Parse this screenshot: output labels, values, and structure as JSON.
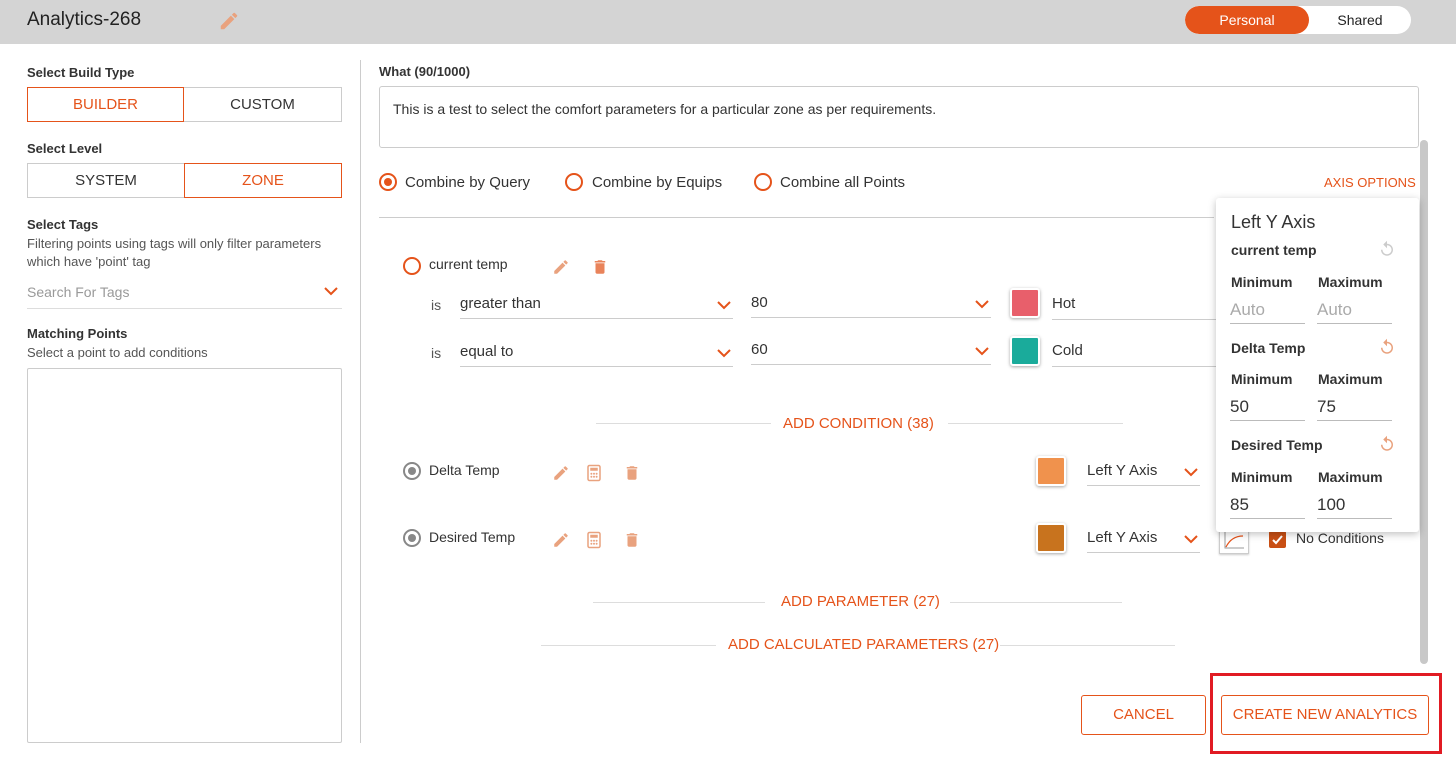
{
  "header": {
    "title": "Analytics-268",
    "toggle": {
      "personal": "Personal",
      "shared": "Shared",
      "selected": "Personal"
    }
  },
  "left": {
    "build_type_label": "Select Build Type",
    "build_types": [
      "BUILDER",
      "CUSTOM"
    ],
    "build_selected": "BUILDER",
    "level_label": "Select Level",
    "levels": [
      "SYSTEM",
      "ZONE"
    ],
    "level_selected": "ZONE",
    "tags_label": "Select Tags",
    "tags_desc_1": "Filtering points using tags will only filter parameters",
    "tags_desc_2": "which have 'point' tag",
    "tags_placeholder": "Search For Tags",
    "matching_label": "Matching Points",
    "matching_desc": "Select a point to add conditions"
  },
  "main": {
    "what_label": "What (90/1000)",
    "what_text": "This is a test to select the comfort parameters for a particular zone as per requirements.",
    "combine_options": [
      "Combine by Query",
      "Combine by Equips",
      "Combine all Points"
    ],
    "combine_selected": "Combine by Query",
    "axis_options": "AXIS OPTIONS",
    "param1": {
      "name": "current temp",
      "conditions": [
        {
          "is": "is",
          "operator": "greater than",
          "value": "80",
          "color": "#e85f6b",
          "label": "Hot"
        },
        {
          "is": "is",
          "operator": "equal to",
          "value": "60",
          "color": "#1aab9b",
          "label": "Cold"
        }
      ]
    },
    "add_condition": "ADD CONDITION (38)",
    "param2": {
      "name": "Delta Temp",
      "color": "#f0924d",
      "axis": "Left Y Axis"
    },
    "param3": {
      "name": "Desired Temp",
      "color": "#c8731e",
      "axis": "Left Y Axis",
      "no_conditions": "No Conditions"
    },
    "add_parameter": "ADD PARAMETER (27)",
    "add_calculated": "ADD CALCULATED PARAMETERS (27)"
  },
  "axis_popover": {
    "title": "Left Y Axis",
    "min_label": "Minimum",
    "max_label": "Maximum",
    "sections": [
      {
        "name": "current temp",
        "min": "",
        "max": "",
        "placeholder": "Auto"
      },
      {
        "name": "Delta Temp",
        "min": "50",
        "max": "75"
      },
      {
        "name": "Desired Temp",
        "min": "85",
        "max": "100"
      }
    ]
  },
  "footer": {
    "cancel": "CANCEL",
    "create": "CREATE NEW ANALYTICS"
  },
  "colors": {
    "accent": "#e5531a",
    "highlight": "#e11b23"
  }
}
